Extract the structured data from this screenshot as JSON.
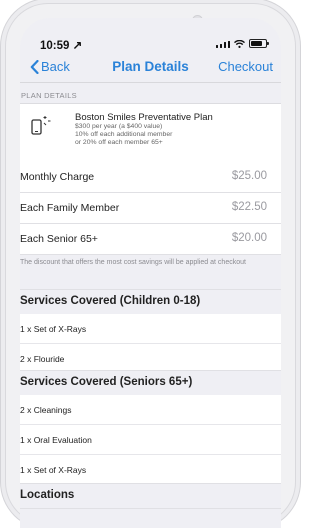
{
  "status_bar": {
    "time": "10:59 ↗"
  },
  "nav": {
    "back_label": "Back",
    "title": "Plan Details",
    "checkout_label": "Checkout"
  },
  "plan_details": {
    "section_label": "PLAN DETAILS",
    "icon": "phone-sparkle-icon",
    "plan_name": "Boston Smiles Preventative Plan",
    "price_line": "$300 per year (a $400 value)",
    "discount_line_1": "10% off each additional member",
    "discount_line_2": "or 20% off each member 65+"
  },
  "pricing": [
    {
      "label": "Monthly Charge",
      "value": "$25.00"
    },
    {
      "label": "Each Family Member",
      "value": "$22.50"
    },
    {
      "label": "Each Senior 65+",
      "value": "$20.00"
    }
  ],
  "discount_note": "The discount that offers the most cost savings will be applied at checkout",
  "children_section": {
    "title": "Services Covered (Children 0-18)",
    "items": [
      "1 x Set of X-Rays",
      "2 x Flouride"
    ]
  },
  "seniors_section": {
    "title": "Services Covered (Seniors 65+)",
    "items": [
      "2 x Cleanings",
      "1 x Oral Evaluation",
      "1 x Set of X-Rays"
    ]
  },
  "locations_section": {
    "title": "Locations"
  },
  "colors": {
    "accent": "#2a82d8",
    "background": "#efeff4",
    "price_gray": "#9a9aa0"
  }
}
